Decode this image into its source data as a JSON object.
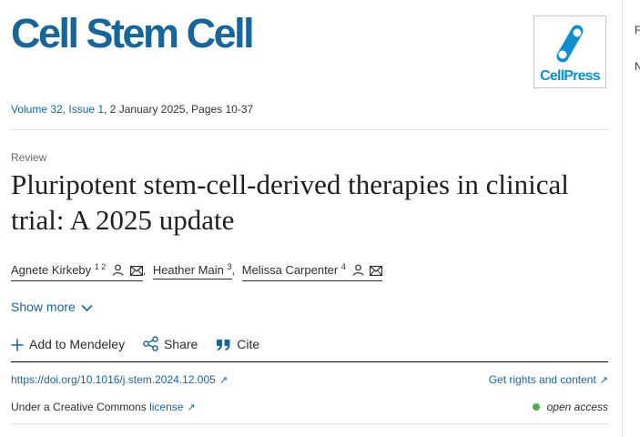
{
  "journal": {
    "title": "Cell Stem Cell",
    "publisher_logo_text": "CellPress"
  },
  "issue": {
    "volume_issue": "Volume 32, Issue 1",
    "rest": ", 2 January 2025, Pages 10-37"
  },
  "article": {
    "type": "Review",
    "title": "Pluripotent stem-cell-derived therapies in clinical trial: A 2025 update",
    "authors": [
      {
        "name": "Agnete Kirkeby",
        "sup": "1 2"
      },
      {
        "name": "Heather Main",
        "sup": "3"
      },
      {
        "name": "Melissa Carpenter",
        "sup": "4"
      }
    ],
    "author_separator": ","
  },
  "show_more": {
    "label": "Show more"
  },
  "actions": {
    "mendeley": "Add to Mendeley",
    "share": "Share",
    "cite": "Cite"
  },
  "links": {
    "doi": "https://doi.org/10.1016/j.stem.2024.12.005",
    "rights": "Get rights and content",
    "license_prefix": "Under a Creative Commons ",
    "license_link": "license",
    "open_access": "open access"
  },
  "edge": {
    "letter_1": "F",
    "letter_2": "N"
  },
  "colors": {
    "brand": "#176599",
    "logo_blue": "#0f8fcf",
    "open_access_dot": "#4caf50"
  },
  "icons": [
    "person-icon",
    "envelope-icon",
    "chevron-down-icon",
    "plus-icon",
    "share-icon",
    "quote-icon",
    "external-link-icon"
  ]
}
